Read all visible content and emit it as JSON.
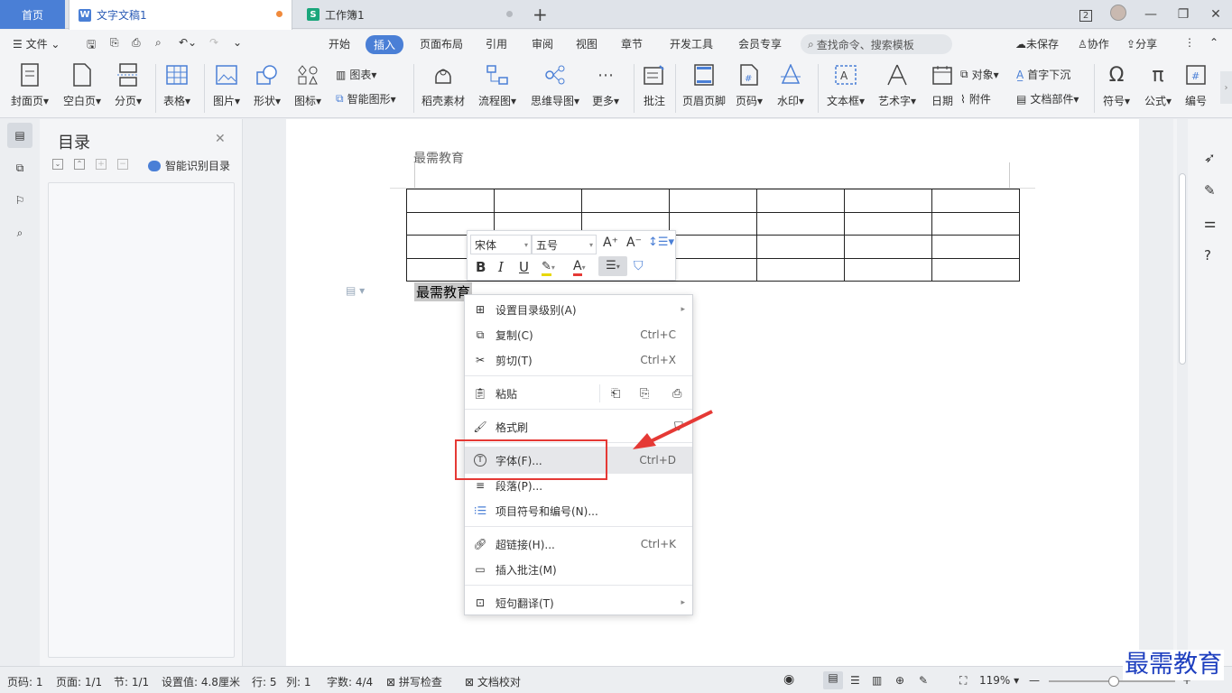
{
  "tabs": {
    "home": "首页",
    "doc": "文字文稿1",
    "sheet": "工作簿1",
    "badge": "2"
  },
  "menubar": {
    "file": "文件",
    "items": [
      "开始",
      "插入",
      "页面布局",
      "引用",
      "审阅",
      "视图",
      "章节",
      "开发工具",
      "会员专享"
    ],
    "search": "查找命令、搜索模板",
    "unsaved": "未保存",
    "collab": "协作",
    "share": "分享"
  },
  "ribbon": {
    "cover": "封面页",
    "blank": "空白页",
    "break": "分页",
    "table": "表格",
    "picture": "图片",
    "shape": "形状",
    "icon": "图标",
    "chart": "图表",
    "smartart": "智能图形",
    "daoke": "稻壳素材",
    "flow": "流程图",
    "mind": "思维导图",
    "more": "更多",
    "comment": "批注",
    "headerfooter": "页眉页脚",
    "pageno": "页码",
    "watermark": "水印",
    "textbox": "文本框",
    "wordart": "艺术字",
    "date": "日期",
    "object": "对象",
    "attach": "附件",
    "dropcap": "首字下沉",
    "docpart": "文档部件",
    "symbol": "符号",
    "formula": "公式",
    "number": "编号"
  },
  "toc": {
    "title": "目录",
    "smart": "智能识别目录"
  },
  "doc": {
    "header_text": "最需教育",
    "body_text": "最需教育"
  },
  "minibar": {
    "font": "宋体",
    "size": "五号",
    "bold": "B",
    "italic": "I",
    "underline": "U"
  },
  "contextmenu": {
    "set_toc_level": "设置目录级别(A)",
    "copy": "复制(C)",
    "copy_sc": "Ctrl+C",
    "cut": "剪切(T)",
    "cut_sc": "Ctrl+X",
    "paste": "粘贴",
    "format_painter": "格式刷",
    "font": "字体(F)...",
    "font_sc": "Ctrl+D",
    "paragraph": "段落(P)...",
    "bullets": "项目符号和编号(N)...",
    "hyperlink": "超链接(H)...",
    "hyperlink_sc": "Ctrl+K",
    "insert_comment": "插入批注(M)",
    "translate": "短句翻译(T)"
  },
  "status": {
    "pageno": "页码: 1",
    "pages": "页面: 1/1",
    "section": "节: 1/1",
    "setting": "设置值: 4.8厘米",
    "row": "行: 5",
    "col": "列: 1",
    "words": "字数: 4/4",
    "spell": "拼写检查",
    "proof": "文档校对",
    "zoom": "119%"
  },
  "watermark": "最需教育",
  "colors": {
    "accent": "#4a7fd6",
    "highlight": "#e53935",
    "wps_doc": "#4a7fd6",
    "wps_sheet": "#1aa67b"
  }
}
